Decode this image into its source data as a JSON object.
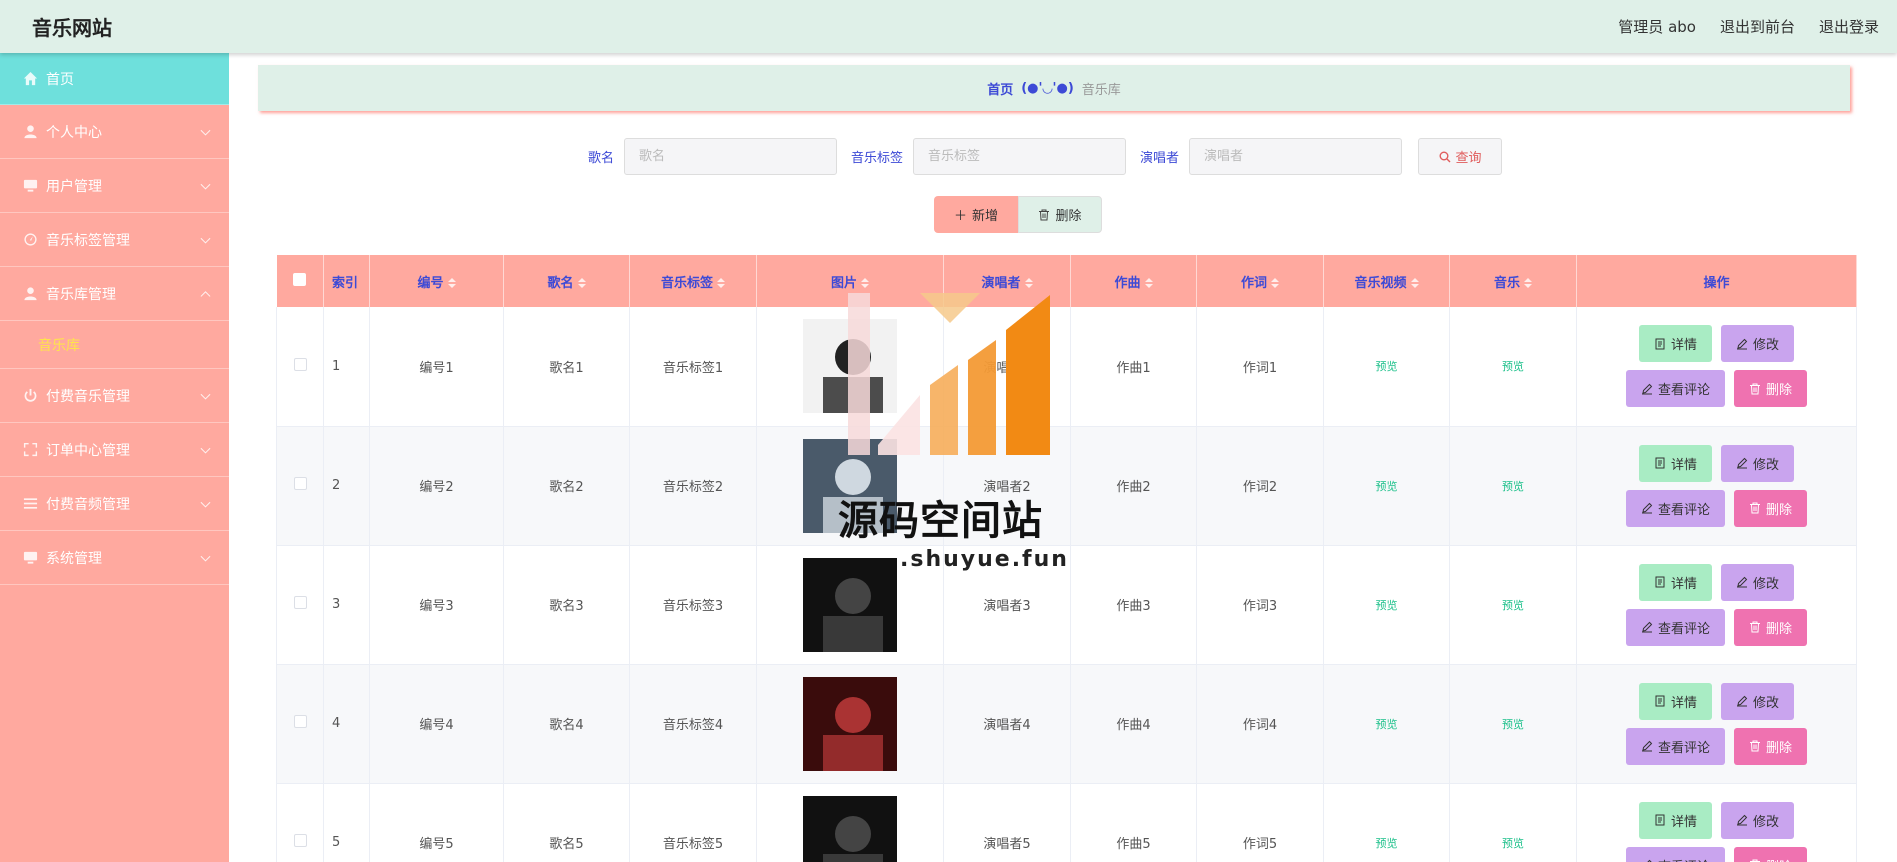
{
  "app": {
    "title": "音乐网站"
  },
  "header": {
    "user": "管理员 abo",
    "to_front": "退出到前台",
    "logout": "退出登录"
  },
  "sidebar": {
    "items": [
      {
        "label": "首页",
        "icon": "home-icon"
      },
      {
        "label": "个人中心",
        "icon": "user-icon"
      },
      {
        "label": "用户管理",
        "icon": "monitor-icon"
      },
      {
        "label": "音乐标签管理",
        "icon": "gauge-icon"
      },
      {
        "label": "音乐库管理",
        "icon": "user-icon",
        "sub": "音乐库"
      },
      {
        "label": "付费音乐管理",
        "icon": "power-icon"
      },
      {
        "label": "订单中心管理",
        "icon": "fullscreen-icon"
      },
      {
        "label": "付费音频管理",
        "icon": "menu-icon"
      },
      {
        "label": "系统管理",
        "icon": "monitor-icon"
      }
    ]
  },
  "breadcrumb": {
    "home": "首页",
    "sep": "(●'◡'●)",
    "current": "音乐库"
  },
  "search": {
    "name_label": "歌名",
    "name_placeholder": "歌名",
    "tag_label": "音乐标签",
    "tag_placeholder": "音乐标签",
    "singer_label": "演唱者",
    "singer_placeholder": "演唱者",
    "query": "查询"
  },
  "actions": {
    "add": "新增",
    "delete": "删除"
  },
  "table": {
    "headers": [
      "索引",
      "编号",
      "歌名",
      "音乐标签",
      "图片",
      "演唱者",
      "作曲",
      "作词",
      "音乐视频",
      "音乐",
      "操作"
    ],
    "rows": [
      {
        "index": "1",
        "code": "编号1",
        "name": "歌名1",
        "tag": "音乐标签1",
        "singer": "演唱者1",
        "composer": "作曲1",
        "lyricist": "作词1",
        "video": "预览",
        "music": "预览"
      },
      {
        "index": "2",
        "code": "编号2",
        "name": "歌名2",
        "tag": "音乐标签2",
        "singer": "演唱者2",
        "composer": "作曲2",
        "lyricist": "作词2",
        "video": "预览",
        "music": "预览"
      },
      {
        "index": "3",
        "code": "编号3",
        "name": "歌名3",
        "tag": "音乐标签3",
        "singer": "演唱者3",
        "composer": "作曲3",
        "lyricist": "作词3",
        "video": "预览",
        "music": "预览"
      },
      {
        "index": "4",
        "code": "编号4",
        "name": "歌名4",
        "tag": "音乐标签4",
        "singer": "演唱者4",
        "composer": "作曲4",
        "lyricist": "作词4",
        "video": "预览",
        "music": "预览"
      },
      {
        "index": "5",
        "code": "编号5",
        "name": "歌名5",
        "tag": "音乐标签5",
        "singer": "演唱者5",
        "composer": "作曲5",
        "lyricist": "作词5",
        "video": "预览",
        "music": "预览"
      }
    ],
    "ops": {
      "detail": "详情",
      "edit": "修改",
      "comment": "查看评论",
      "delete": "删除"
    }
  },
  "watermark": {
    "text": "源码空间站",
    "url": ".shuyue.fun"
  },
  "colors": {
    "sidebar": "#ffa99f",
    "active": "#6ee0dc",
    "header": "#dff0e8",
    "accent": "#3d4ad6",
    "preview": "#1cc08a"
  }
}
